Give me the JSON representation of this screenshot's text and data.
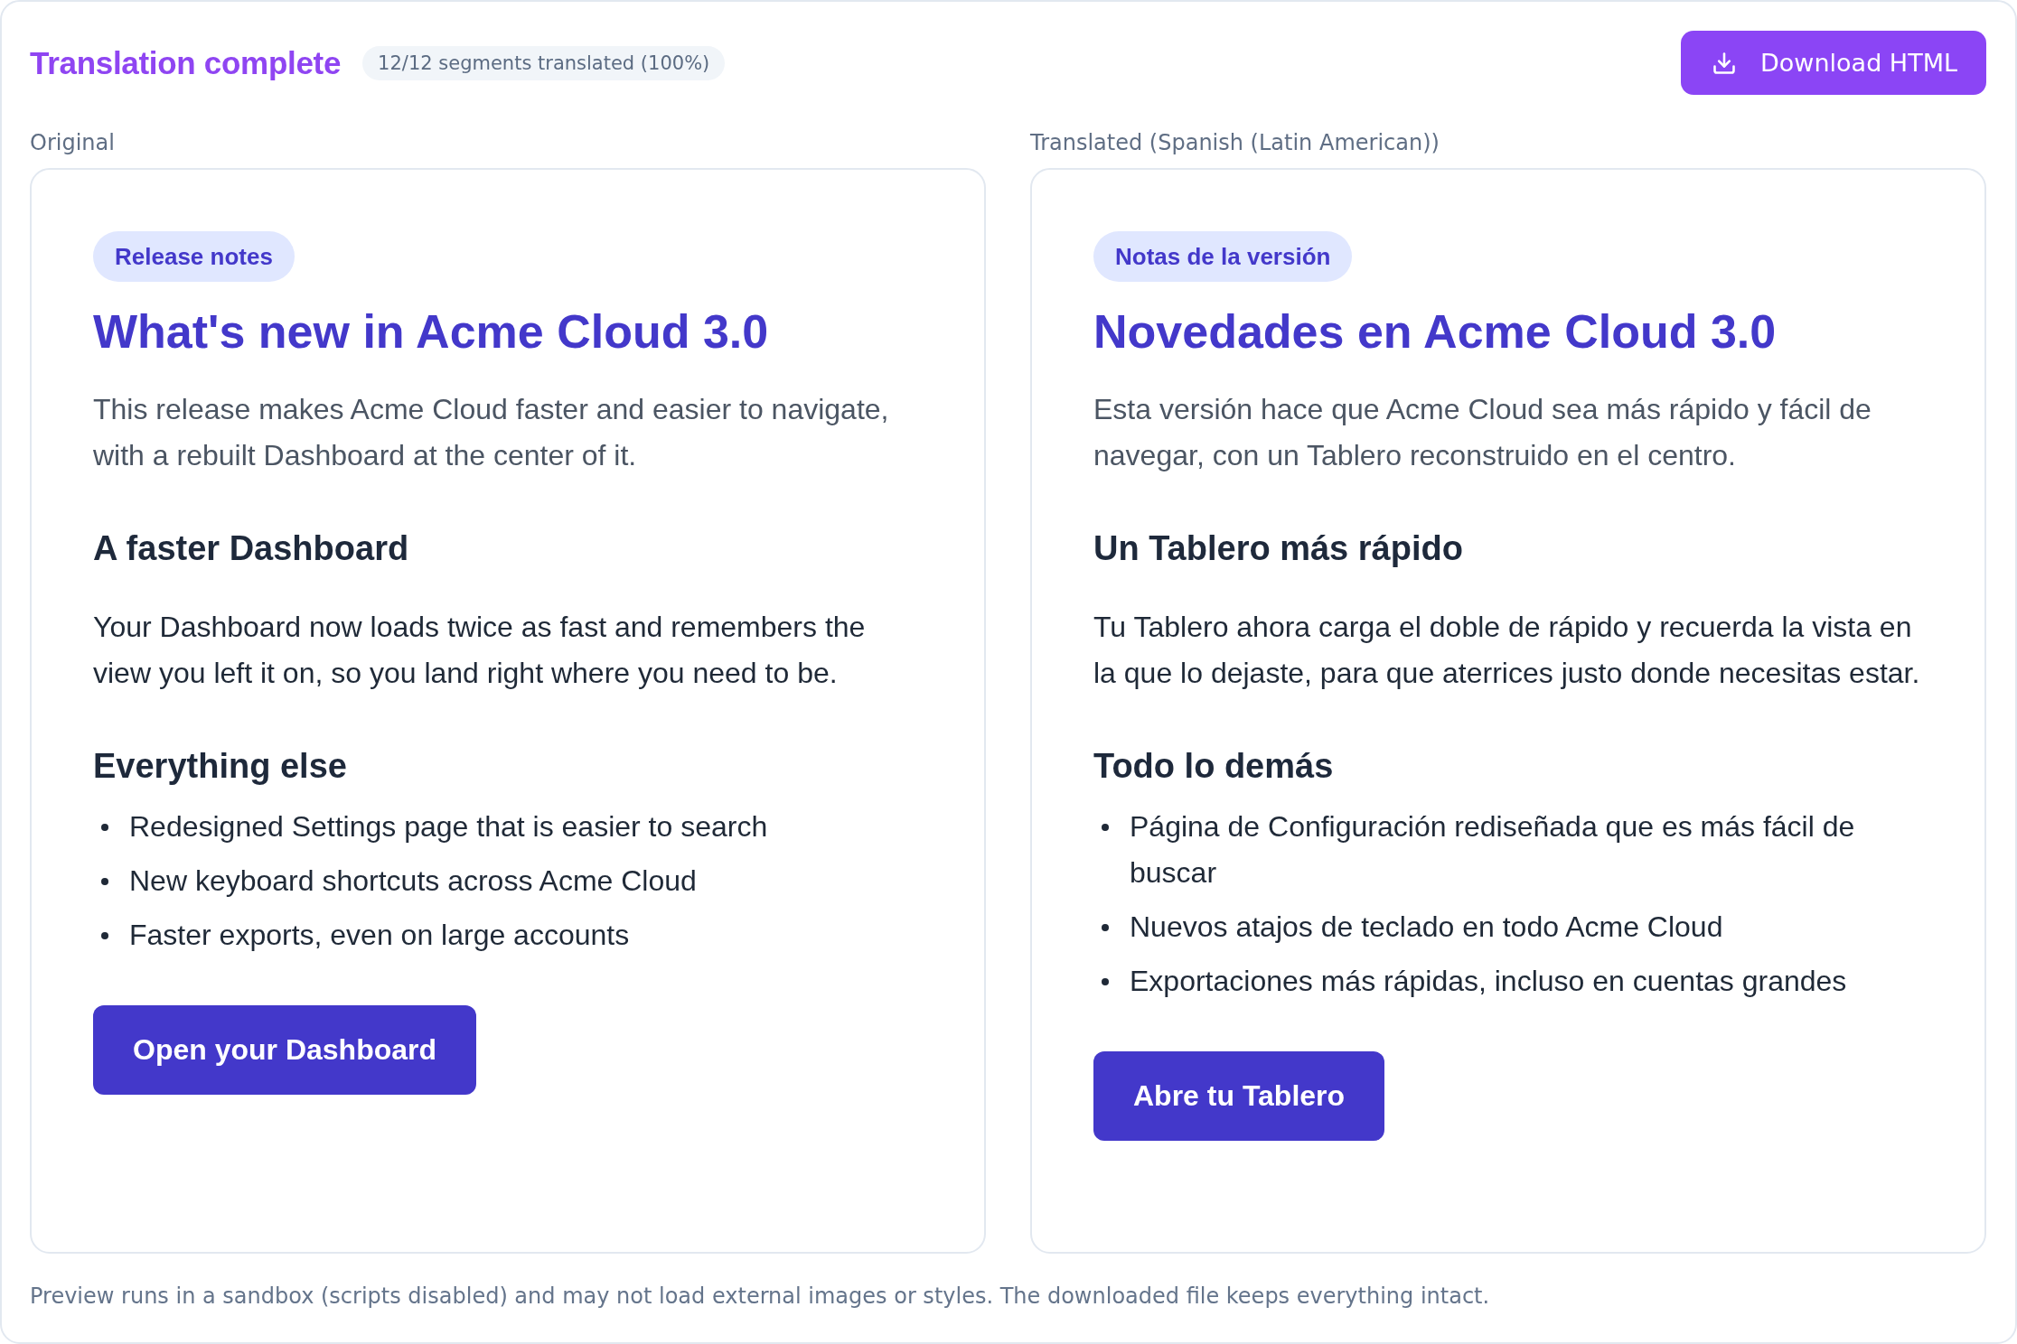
{
  "header": {
    "title": "Translation complete",
    "progress": "12/12 segments translated (100%)",
    "download_button": "Download HTML"
  },
  "panes": [
    {
      "label": "Original",
      "preview": {
        "tag": "Release notes",
        "heading": "What's new in Acme Cloud 3.0",
        "intro": "This release makes Acme Cloud faster and easier to navigate, with a rebuilt Dashboard at the center of it.",
        "sections": [
          {
            "kind": "paragraph",
            "heading": "A faster Dashboard",
            "text": "Your Dashboard now loads twice as fast and remembers the view you left it on, so you land right where you need to be."
          },
          {
            "kind": "list",
            "heading": "Everything else",
            "items": [
              "Redesigned Settings page that is easier to search",
              "New keyboard shortcuts across Acme Cloud",
              "Faster exports, even on large accounts"
            ]
          }
        ],
        "button": "Open your Dashboard"
      }
    },
    {
      "label": "Translated (Spanish (Latin American))",
      "preview": {
        "tag": "Notas de la versión",
        "heading": "Novedades en Acme Cloud 3.0",
        "intro": "Esta versión hace que Acme Cloud sea más rápido y fácil de navegar, con un Tablero reconstruido en el centro.",
        "sections": [
          {
            "kind": "paragraph",
            "heading": "Un Tablero más rápido",
            "text": "Tu Tablero ahora carga el doble de rápido y recuerda la vista en la que lo dejaste, para que aterrices justo donde necesitas estar."
          },
          {
            "kind": "list",
            "heading": "Todo lo demás",
            "items": [
              "Página de Configuración rediseñada que es más fácil de buscar",
              "Nuevos atajos de teclado en todo Acme Cloud",
              "Exportaciones más rápidas, incluso en cuentas grandes"
            ]
          }
        ],
        "button": "Abre tu Tablero"
      }
    }
  ],
  "footer_note": "Preview runs in a sandbox (scripts disabled) and may not load external images or styles. The downloaded file keeps everything intact."
}
